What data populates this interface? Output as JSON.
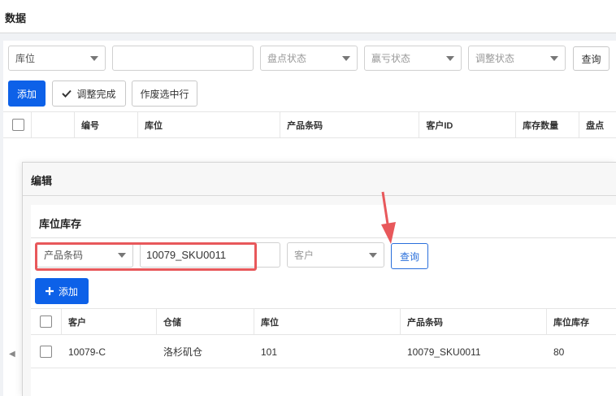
{
  "page": {
    "title": "数据"
  },
  "filters": {
    "location_select": "库位",
    "text_value": "",
    "count_status_placeholder": "盘点状态",
    "profit_loss_status_placeholder": "赢亏状态",
    "adjust_status_placeholder": "调整状态",
    "query_label": "查询"
  },
  "toolbar": {
    "add_label": "添加",
    "adjust_done_label": "调整完成",
    "void_selected_label": "作废选中行"
  },
  "main_table": {
    "columns": [
      "编号",
      "库位",
      "产品条码",
      "客户ID",
      "库存数量",
      "盘点"
    ]
  },
  "modal": {
    "title": "编辑",
    "section_title": "库位库存",
    "filter_field_select": "产品条码",
    "filter_value": "10079_SKU0011",
    "customer_placeholder": "客户",
    "query_label": "查询",
    "add_label": "添加",
    "columns": [
      "客户",
      "仓储",
      "库位",
      "产品条码",
      "库位库存"
    ],
    "rows": [
      {
        "customer": "10079-C",
        "warehouse": "洛杉矶仓",
        "location": "101",
        "barcode": "10079_SKU0011",
        "stock": "80"
      }
    ]
  },
  "colors": {
    "primary": "#0d61e8",
    "annotation": "#e8585b"
  },
  "icons": {
    "check": "check-icon",
    "plus": "plus-icon",
    "caret": "chevron-down-icon",
    "left": "chevron-left-icon"
  }
}
